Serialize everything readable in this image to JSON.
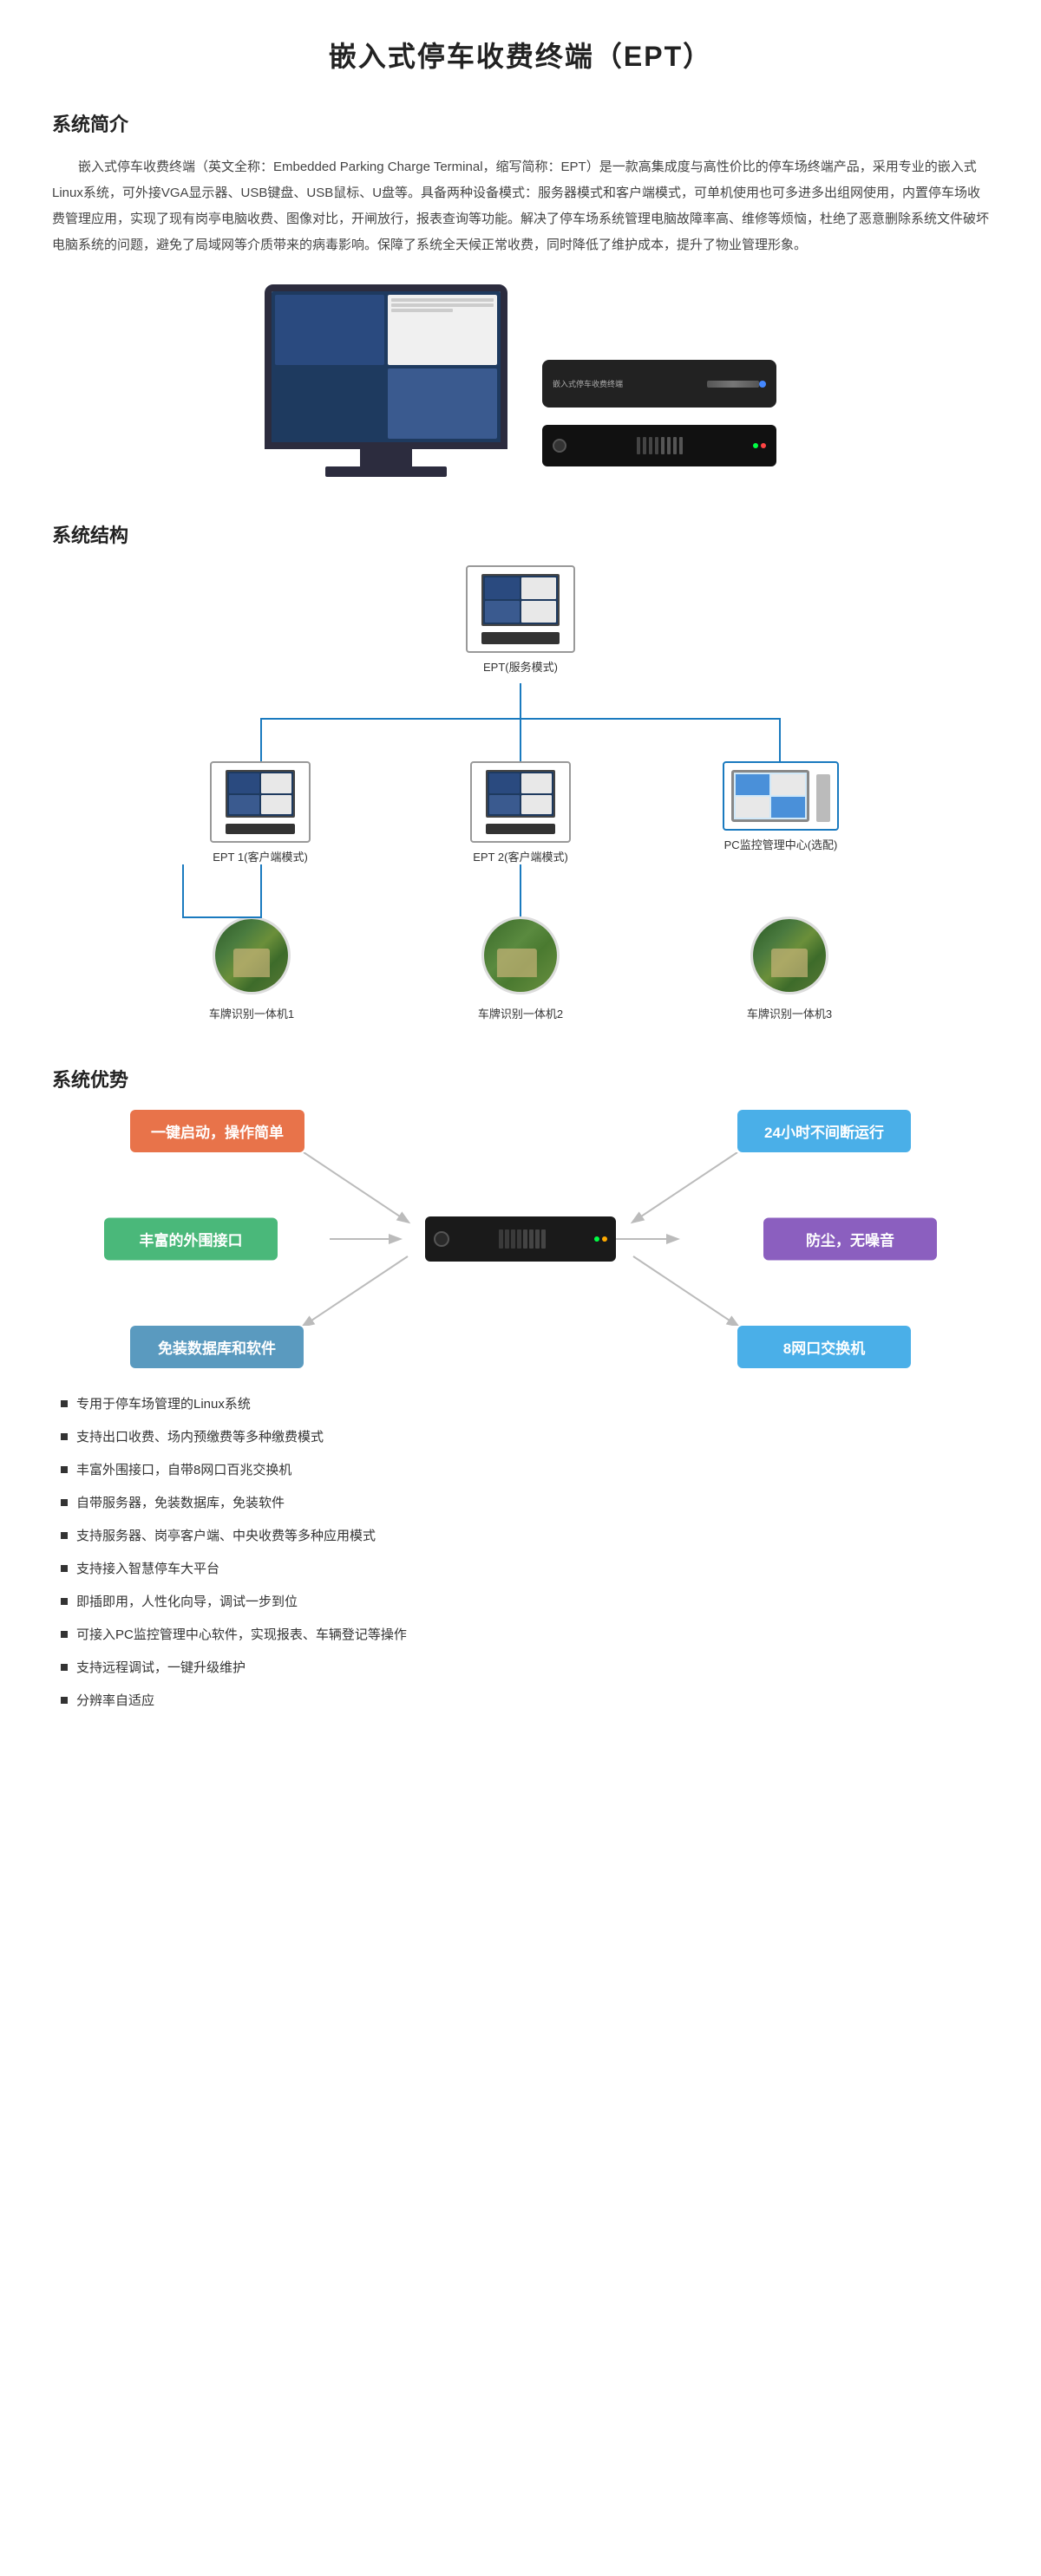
{
  "page": {
    "title": "嵌入式停车收费终端（EPT）"
  },
  "sections": {
    "intro": {
      "title": "系统简介",
      "content": "嵌入式停车收费终端（英文全称：Embedded Parking Charge Terminal，缩写简称：EPT）是一款高集成度与高性价比的停车场终端产品，采用专业的嵌入式Linux系统，可外接VGA显示器、USB键盘、USB鼠标、U盘等。具备两种设备模式：服务器模式和客户端模式，可单机使用也可多进多出组网使用，内置停车场收费管理应用，实现了现有岗亭电脑收费、图像对比，开闸放行，报表查询等功能。解决了停车场系统管理电脑故障率高、维修等烦恼，杜绝了恶意删除系统文件破坏电脑系统的问题，避免了局域网等介质带来的病毒影响。保障了系统全天候正常收费，同时降低了维护成本，提升了物业管理形象。"
    },
    "structure": {
      "title": "系统结构",
      "nodes": {
        "top": "EPT(服务模式)",
        "left": "EPT 1(客户端模式)",
        "middle": "EPT 2(客户端模式)",
        "right": "PC监控管理中心(选配)"
      },
      "cameras": {
        "cam1": "车牌识别一体机1",
        "cam2": "车牌识别一体机2",
        "cam3": "车牌识别一体机3"
      }
    },
    "advantages": {
      "title": "系统优势",
      "boxes": {
        "top_left": "一键启动，操作简单",
        "top_right": "24小时不间断运行",
        "left": "丰富的外围接口",
        "right": "防尘，无噪音",
        "bottom_left": "免装数据库和软件",
        "bottom_right": "8网口交换机"
      },
      "features": [
        "专用于停车场管理的Linux系统",
        "支持出口收费、场内预缴费等多种缴费模式",
        "丰富外围接口，自带8网口百兆交换机",
        "自带服务器，免装数据库，免装软件",
        "支持服务器、岗亭客户端、中央收费等多种应用模式",
        "支持接入智慧停车大平台",
        "即插即用，人性化向导，调试一步到位",
        "可接入PC监控管理中心软件，实现报表、车辆登记等操作",
        "支持远程调试，一键升级维护",
        "分辨率自适应"
      ]
    }
  }
}
